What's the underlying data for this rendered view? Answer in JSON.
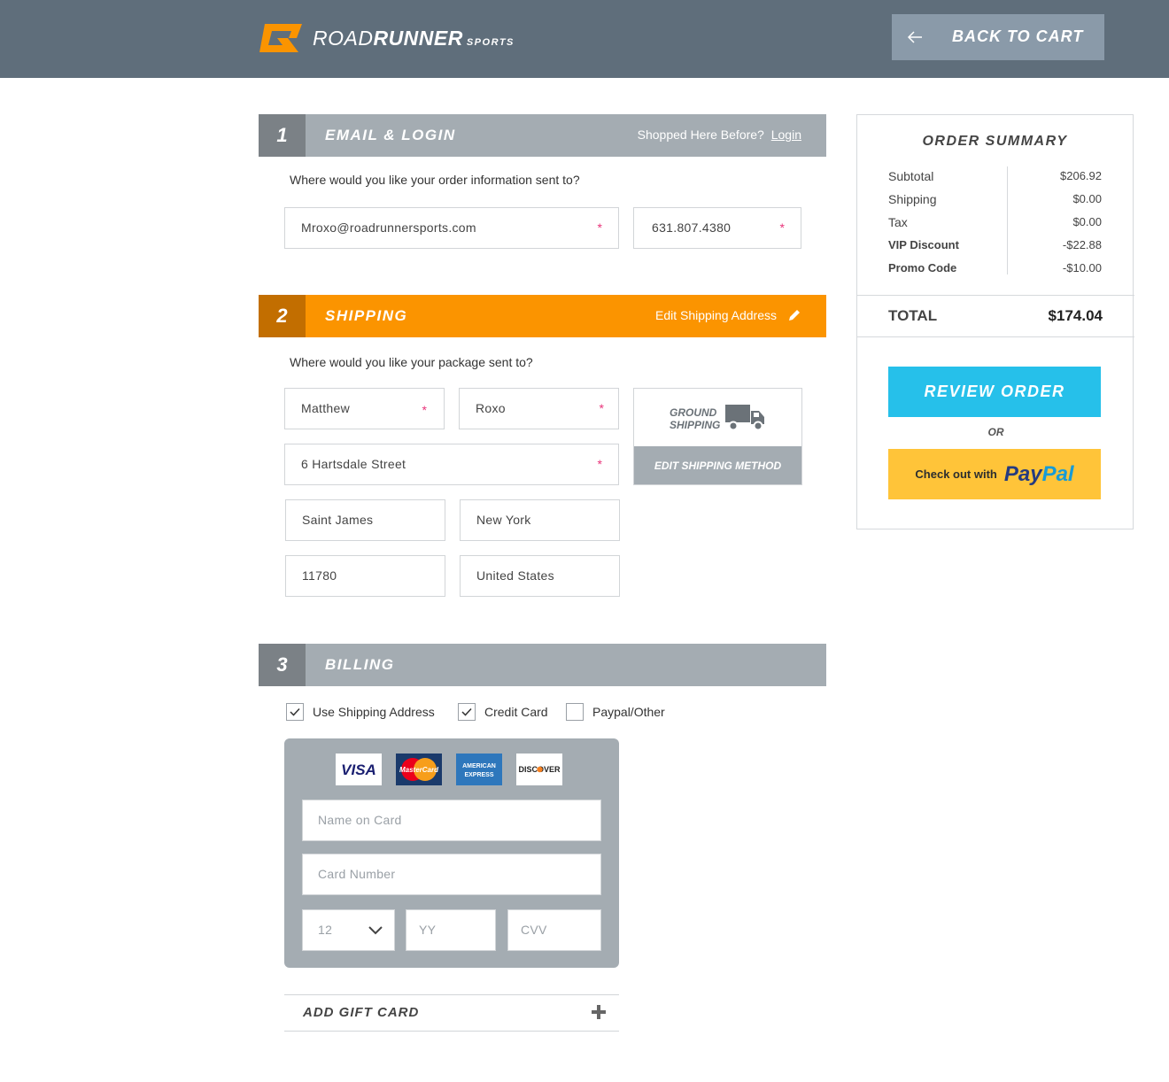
{
  "header": {
    "brand_main_light": "ROAD",
    "brand_main_bold": "RUNNER",
    "brand_sub": "SPORTS",
    "back_label": "BACK TO CART",
    "bg_color": "#5f6e7b"
  },
  "email_section": {
    "number": "1",
    "title": "EMAIL & LOGIN",
    "right_text": "Shopped Here Before?",
    "login_link": "Login",
    "prompt": "Where would you like your order information sent to?",
    "email_value": "Mroxo@roadrunnersports.com",
    "phone_value": "631.807.4380",
    "required_mark": "*"
  },
  "shipping_section": {
    "number": "2",
    "title": "SHIPPING",
    "edit_label": "Edit Shipping Address",
    "prompt": "Where would you like your package sent to?",
    "first_name": "Matthew",
    "last_name": "Roxo",
    "street": "6 Hartsdale Street",
    "city": "Saint James",
    "state": "New York",
    "zip": "11780",
    "country": "United States",
    "method_line1": "GROUND",
    "method_line2": "SHIPPING",
    "method_edit": "EDIT SHIPPING METHOD",
    "accent_color": "#fb9400"
  },
  "billing_section": {
    "number": "3",
    "title": "BILLING",
    "options": [
      {
        "label": "Use Shipping Address",
        "checked": true
      },
      {
        "label": "Credit Card",
        "checked": true
      },
      {
        "label": "Paypal/Other",
        "checked": false
      }
    ],
    "card_brands": [
      "VISA",
      "MasterCard",
      "AMERICAN EXPRESS",
      "DISCOVER"
    ],
    "name_placeholder": "Name on Card",
    "number_placeholder": "Card Number",
    "month_value": "12",
    "year_placeholder": "YY",
    "cvv_placeholder": "CVV",
    "gift_label": "ADD GIFT CARD"
  },
  "summary": {
    "title": "ORDER SUMMARY",
    "rows": [
      {
        "label": "Subtotal",
        "value": "$206.92",
        "bold": false
      },
      {
        "label": "Shipping",
        "value": "$0.00",
        "bold": false
      },
      {
        "label": "Tax",
        "value": "$0.00",
        "bold": false
      },
      {
        "label": "VIP Discount",
        "value": "-$22.88",
        "bold": true
      },
      {
        "label": "Promo Code",
        "value": "-$10.00",
        "bold": true
      }
    ],
    "total_label": "TOTAL",
    "total_value": "$174.04",
    "review_label": "REVIEW ORDER",
    "or_label": "OR",
    "paypal_prefix": "Check out with",
    "paypal_pay": "Pay",
    "paypal_pal": "Pal",
    "review_color": "#26c0ea",
    "paypal_color": "#ffc439"
  }
}
